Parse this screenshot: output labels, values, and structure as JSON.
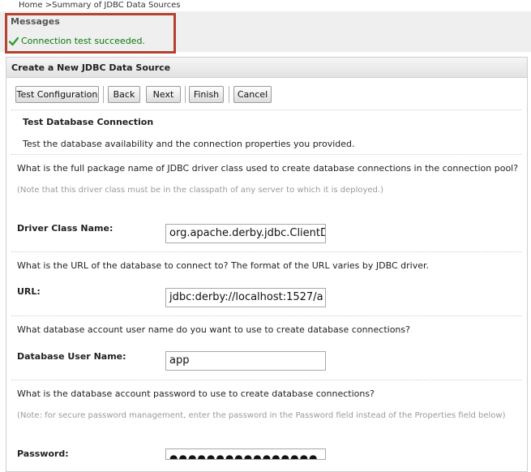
{
  "breadcrumb": {
    "home": "Home",
    "sep": " >",
    "current": "Summary of JDBC Data Sources"
  },
  "messages": {
    "title": "Messages",
    "items": [
      "Connection test succeeded."
    ],
    "icon": "check-icon",
    "success_color": "#0b7a0b",
    "highlight_color": "#b5412f"
  },
  "panel": {
    "title": "Create a New JDBC Data Source"
  },
  "toolbar": {
    "test_label": "Test Configuration",
    "back_label": "Back",
    "next_label": "Next",
    "finish_label": "Finish",
    "cancel_label": "Cancel"
  },
  "section": {
    "title": "Test Database Connection",
    "description": "Test the database availability and the connection properties you provided."
  },
  "driver": {
    "question": "What is the full package name of JDBC driver class used to create database connections in the connection pool?",
    "note": "(Note that this driver class must be in the classpath of any server to which it is deployed.)",
    "label": "Driver Class Name:",
    "value": "org.apache.derby.jdbc.ClientDriver"
  },
  "url": {
    "question": "What is the URL of the database to connect to? The format of the URL varies by JDBC driver.",
    "label": "URL:",
    "value": "jdbc:derby://localhost:1527/a"
  },
  "user": {
    "question": "What database account user name do you want to use to create database connections?",
    "label": "Database User Name:",
    "value": "app"
  },
  "password": {
    "question": "What is the database account password to use to create database connections?",
    "note": "(Note: for secure password management, enter the password in the Password field instead of the Properties field below)",
    "label": "Password:",
    "value": "●●●●●●●●●●●●●●●●"
  }
}
